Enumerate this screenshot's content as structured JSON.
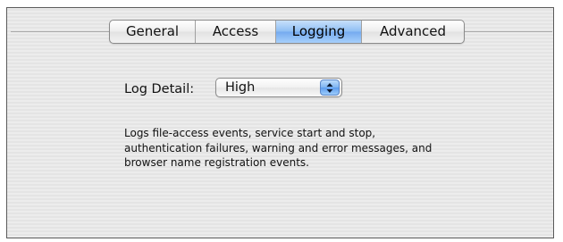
{
  "tabs": [
    {
      "label": "General",
      "active": false
    },
    {
      "label": "Access",
      "active": false
    },
    {
      "label": "Logging",
      "active": true
    },
    {
      "label": "Advanced",
      "active": false
    }
  ],
  "log_detail": {
    "label": "Log Detail:",
    "selected": "High"
  },
  "description": "Logs file-access events, service start and stop, authentication failures, warning and error messages, and browser name registration events.",
  "colors": {
    "active_tab": "#8dbdf3",
    "stepper": "#7cb4f2"
  },
  "icons": {
    "stepper": "up-down-arrows-icon"
  }
}
